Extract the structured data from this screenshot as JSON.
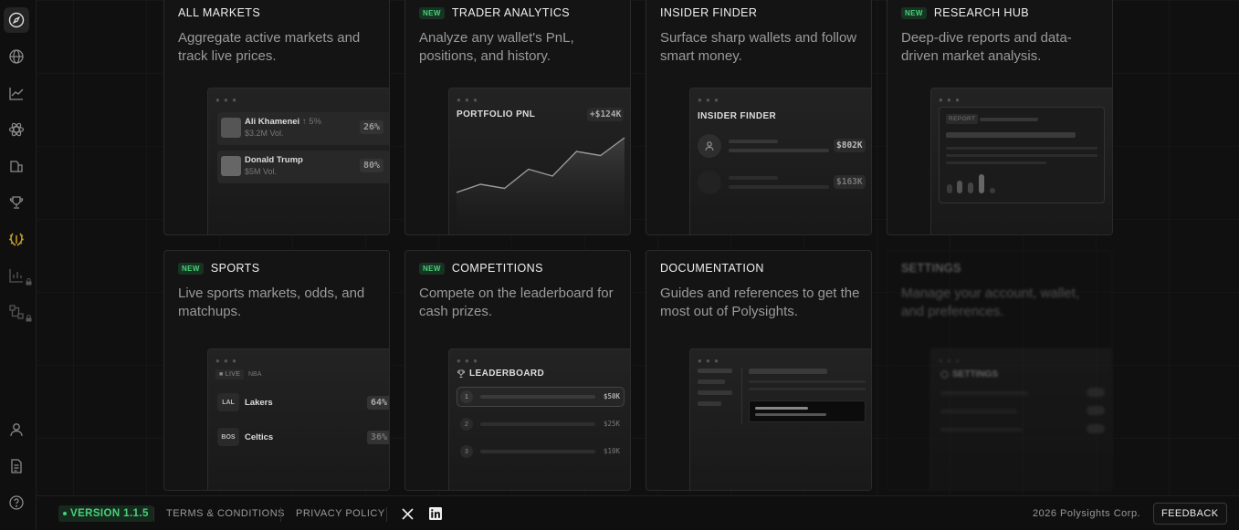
{
  "cards": [
    {
      "title": "ALL MARKETS",
      "desc": "Aggregate active markets and track live prices.",
      "new": false,
      "preview": {
        "rows": [
          {
            "name": "Ali Khamenei",
            "change": "↑ 5%",
            "vol": "$3.2M Vol.",
            "pct": "26%"
          },
          {
            "name": "Donald Trump",
            "vol": "$5M Vol.",
            "pct": "80%"
          }
        ]
      }
    },
    {
      "title": "TRADER ANALYTICS",
      "desc": "Analyze any wallet's PnL, positions, and history.",
      "new": true,
      "badge": "NEW",
      "preview": {
        "title": "PORTFOLIO PNL",
        "value": "+$124K",
        "series": [
          10,
          16,
          13,
          27,
          22,
          40,
          37,
          50
        ]
      }
    },
    {
      "title": "INSIDER FINDER",
      "desc": "Surface sharp wallets and follow smart money.",
      "new": false,
      "preview": {
        "title": "INSIDER FINDER",
        "amounts": [
          "$802K",
          "$163K"
        ]
      }
    },
    {
      "title": "RESEARCH HUB",
      "desc": "Deep-dive reports and data-driven market analysis.",
      "new": true,
      "badge": "NEW",
      "preview": {
        "tag": "REPORT"
      }
    },
    {
      "title": "SPORTS",
      "desc": "Live sports markets, odds, and matchups.",
      "new": true,
      "badge": "NEW",
      "preview": {
        "live": "LIVE",
        "league": "NBA",
        "rows": [
          {
            "abbr": "LAL",
            "team": "Lakers",
            "pct": "64%"
          },
          {
            "abbr": "BOS",
            "team": "Celtics",
            "pct": "36%"
          }
        ]
      }
    },
    {
      "title": "COMPETITIONS",
      "desc": "Compete on the leaderboard for cash prizes.",
      "new": true,
      "badge": "NEW",
      "preview": {
        "title": "LEADERBOARD",
        "rows": [
          {
            "rank": "1",
            "prize": "$50K"
          },
          {
            "rank": "2",
            "prize": "$25K"
          },
          {
            "rank": "3",
            "prize": "$10K"
          }
        ]
      }
    },
    {
      "title": "DOCUMENTATION",
      "desc": "Guides and references to get the most out of Polysights.",
      "new": false
    },
    {
      "title": "SETTINGS",
      "desc": "Manage your account, wallet, and preferences.",
      "new": false,
      "preview": {
        "title": "SETTINGS"
      }
    }
  ],
  "footer": {
    "version": "VERSION 1.1.5",
    "terms": "TERMS & CONDITIONS",
    "privacy": "PRIVACY POLICY",
    "copyright": "2026 Polysights Corp.",
    "feedback": "FEEDBACK"
  },
  "colors": {
    "accent": "#49d07a",
    "gold": "#c9a227",
    "bg": "#101010"
  },
  "sidebar_icons": [
    "compass-icon",
    "globe-icon",
    "chart-icon",
    "atom-icon",
    "stack-icon",
    "trophy-icon",
    "laurel-icon",
    "bar-chart-icon",
    "network-icon",
    "user-icon",
    "document-icon",
    "help-icon"
  ]
}
